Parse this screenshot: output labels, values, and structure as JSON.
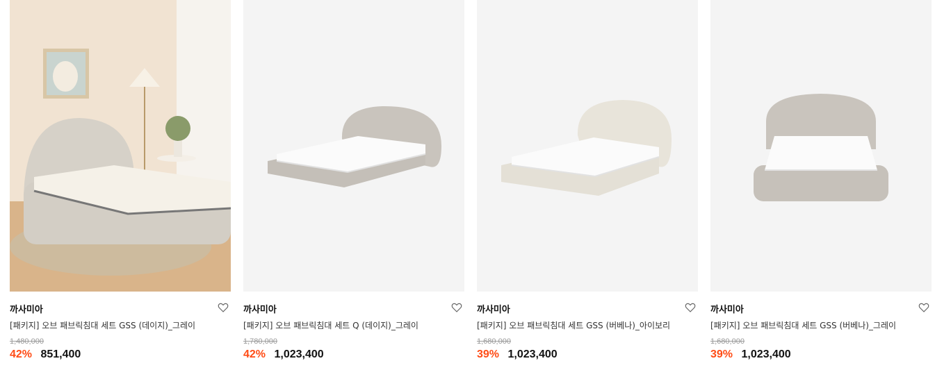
{
  "products": [
    {
      "image_icon": "room-bed-photo",
      "brand": "까사미아",
      "name": "[패키지] 오브 패브릭침대 세트 GSS (데이지)_그레이",
      "original_price": "1,480,000",
      "discount": "42%",
      "price": "851,400",
      "frame_color": "#d6d1c8"
    },
    {
      "image_icon": "bed-product-photo",
      "brand": "까사미아",
      "name": "[패키지] 오브 패브릭침대 세트 Q (데이지)_그레이",
      "original_price": "1,780,000",
      "discount": "42%",
      "price": "1,023,400",
      "frame_color": "#c9c4bd"
    },
    {
      "image_icon": "bed-product-photo",
      "brand": "까사미아",
      "name": "[패키지] 오브 패브릭침대 세트 GSS (버베나)_아이보리",
      "original_price": "1,680,000",
      "discount": "39%",
      "price": "1,023,400",
      "frame_color": "#e8e4da"
    },
    {
      "image_icon": "bed-front-photo",
      "brand": "까사미아",
      "name": "[패키지] 오브 패브릭침대 세트 GSS (버베나)_그레이",
      "original_price": "1,680,000",
      "discount": "39%",
      "price": "1,023,400",
      "frame_color": "#c9c4bd"
    }
  ],
  "wishlist_icon": "heart-outline-icon",
  "discount_color": "#ff4c16"
}
